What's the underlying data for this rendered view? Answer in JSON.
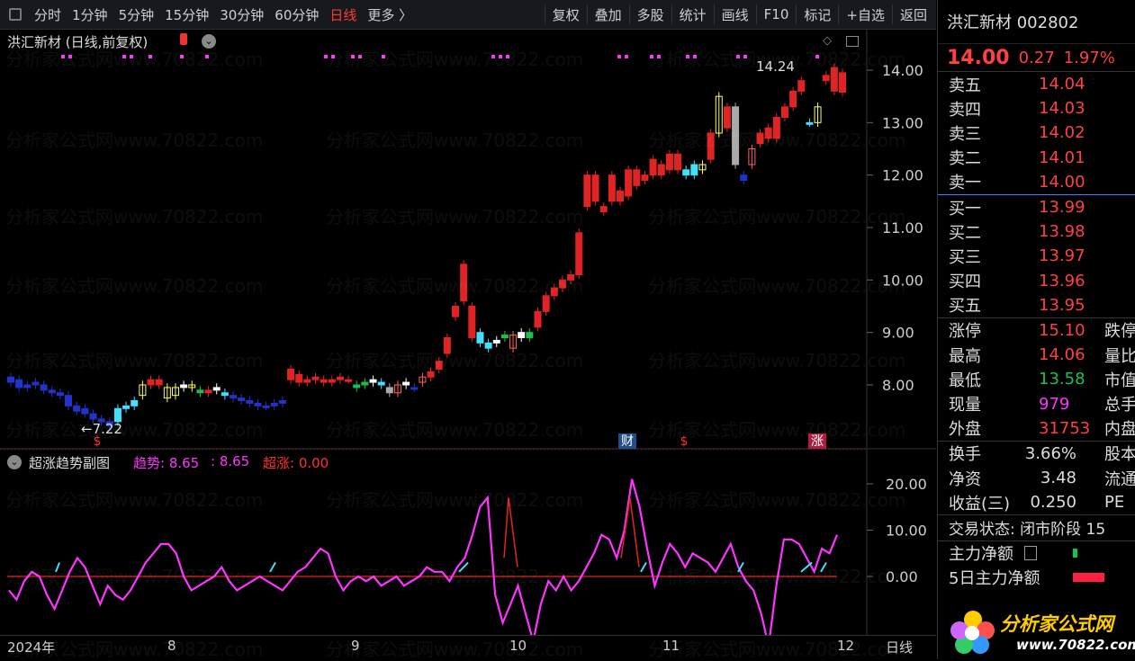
{
  "toolbar": {
    "items": [
      "分时",
      "1分钟",
      "5分钟",
      "15分钟",
      "30分钟",
      "60分钟",
      "日线",
      "更多 〉"
    ],
    "active": "日线",
    "tools": [
      "复权",
      "叠加",
      "多股",
      "统计",
      "画线",
      "F10",
      "标记",
      "+自选",
      "返回"
    ]
  },
  "main": {
    "title": "洪汇新材 (日线,前复权)",
    "y_ticks": [
      "14.00",
      "13.00",
      "12.00",
      "11.00",
      "10.00",
      "9.00",
      "8.00"
    ],
    "high_mark": "14.24",
    "low_mark": "←7.22",
    "events": [
      {
        "label": "$",
        "color": "#ff3030",
        "bg": "none"
      },
      {
        "label": "财",
        "color": "#ffffff",
        "bg": "#1f4f8a"
      },
      {
        "label": "$",
        "color": "#ff3030",
        "bg": "none"
      },
      {
        "label": "涨",
        "color": "#ffffff",
        "bg": "#a82040"
      }
    ]
  },
  "sub": {
    "title": "超涨趋势副图",
    "trend_label": "趋势: 8.65",
    "trend_value": ": 8.65",
    "super_label": "超涨: 0.00",
    "y_ticks": [
      "20.00",
      "10.00",
      "0.00"
    ]
  },
  "xaxis": {
    "labels": [
      "2024年",
      "8",
      "9",
      "10",
      "11",
      "12"
    ],
    "period": "日线"
  },
  "watermark": "分析家公式网www.70822.com",
  "panel": {
    "name": "洪汇新材 002802",
    "price": "14.00",
    "change": "0.27",
    "pct": "1.97%",
    "asks": [
      {
        "label": "卖五",
        "price": "14.04"
      },
      {
        "label": "卖四",
        "price": "14.03"
      },
      {
        "label": "卖三",
        "price": "14.02"
      },
      {
        "label": "卖二",
        "price": "14.01"
      },
      {
        "label": "卖一",
        "price": "14.00"
      }
    ],
    "bids": [
      {
        "label": "买一",
        "price": "13.99"
      },
      {
        "label": "买二",
        "price": "13.98"
      },
      {
        "label": "买三",
        "price": "13.97"
      },
      {
        "label": "买四",
        "price": "13.96"
      },
      {
        "label": "买五",
        "price": "13.95"
      }
    ],
    "stats": [
      {
        "label": "涨停",
        "value": "15.10",
        "color": "red",
        "label2": "跌停"
      },
      {
        "label": "最高",
        "value": "14.06",
        "color": "red",
        "label2": "量比"
      },
      {
        "label": "最低",
        "value": "13.58",
        "color": "green",
        "label2": "市值"
      },
      {
        "label": "现量",
        "value": "979",
        "color": "magenta",
        "label2": "总手"
      },
      {
        "label": "外盘",
        "value": "31753",
        "color": "red",
        "label2": "内盘"
      }
    ],
    "stats2": [
      {
        "label": "换手",
        "value": "3.66%",
        "label2": "股本"
      },
      {
        "label": "净资",
        "value": "3.48",
        "label2": "流通"
      },
      {
        "label": "收益(三)",
        "value": "0.250",
        "label2": "PE"
      }
    ],
    "trade_status": "交易状态: 闭市阶段 15",
    "main_net": "主力净额",
    "main_net5": "5日主力净额"
  },
  "logo": {
    "text": "分析家公式网",
    "url": "www.70822.com"
  }
}
